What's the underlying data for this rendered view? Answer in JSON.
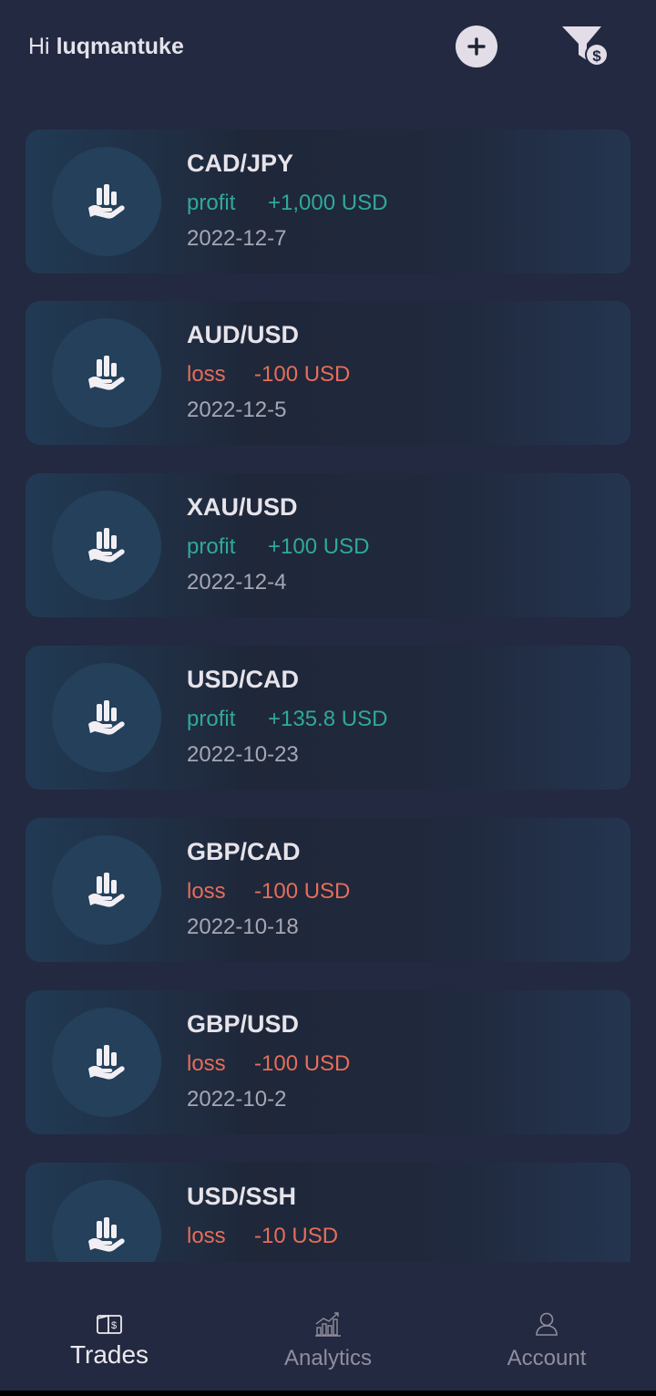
{
  "header": {
    "greeting": "Hi",
    "username": "luqmantuke"
  },
  "trades": [
    {
      "pair": "CAD/JPY",
      "result": "profit",
      "amount": "+1,000 USD",
      "date": "2022-12-7"
    },
    {
      "pair": "AUD/USD",
      "result": "loss",
      "amount": "-100 USD",
      "date": "2022-12-5"
    },
    {
      "pair": "XAU/USD",
      "result": "profit",
      "amount": "+100 USD",
      "date": "2022-12-4"
    },
    {
      "pair": "USD/CAD",
      "result": "profit",
      "amount": "+135.8 USD",
      "date": "2022-10-23"
    },
    {
      "pair": "GBP/CAD",
      "result": "loss",
      "amount": "-100 USD",
      "date": "2022-10-18"
    },
    {
      "pair": "GBP/USD",
      "result": "loss",
      "amount": "-100 USD",
      "date": "2022-10-2"
    },
    {
      "pair": "USD/SSH",
      "result": "loss",
      "amount": "-10 USD",
      "date": ""
    }
  ],
  "nav": {
    "trades_label": "Trades",
    "analytics_label": "Analytics",
    "account_label": "Account"
  },
  "colors": {
    "background": "#232940",
    "profit": "#2fa99b",
    "loss": "#e66d5a"
  },
  "icons": {
    "add": "plus-circle-icon",
    "filter": "filter-dollar-icon",
    "trade": "hand-chart-icon",
    "trades": "wallet-icon",
    "analytics": "bar-chart-icon",
    "account": "user-icon"
  }
}
